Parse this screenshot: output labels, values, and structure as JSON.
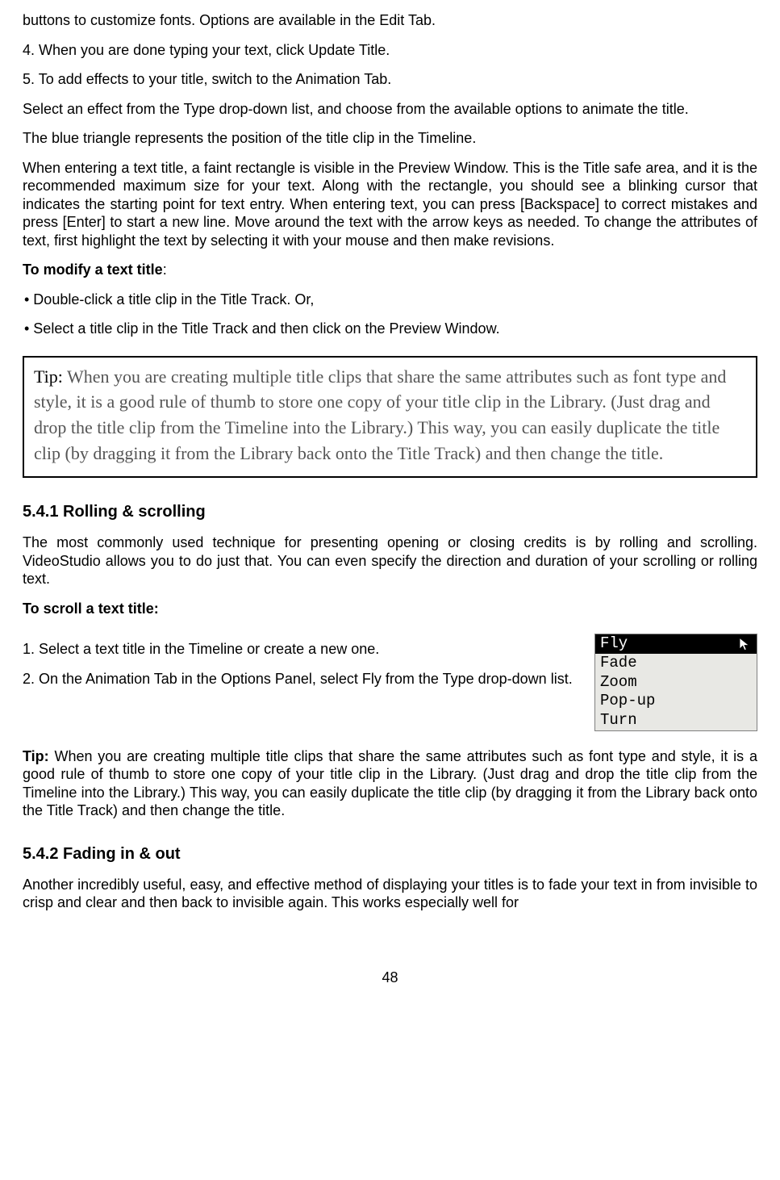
{
  "para_buttons": "buttons to customize fonts. Options are available in the Edit Tab.",
  "step4": "4. When you are done typing your text, click Update Title.",
  "step5": "5. To add effects to your title, switch to the Animation Tab.",
  "para_effect_select": "Select an effect from the Type drop-down list, and choose from the available options to animate the title.",
  "para_blue_triangle": "The blue triangle represents the position of the title clip in the Timeline.",
  "para_text_entry": "When entering a text title, a faint rectangle is visible in the Preview Window. This is the Title safe area, and it is the recommended maximum size for your text. Along with the rectangle, you should see a blinking cursor that indicates the starting point for text entry. When entering text, you can press [Backspace] to correct mistakes and press [Enter] to start a new line. Move around the text with the arrow keys as needed. To change the attributes of text, first highlight the text by selecting it with your mouse and then make revisions.",
  "modify_heading": "To modify a text title",
  "modify_colon": ":",
  "bullet1": "•  Double-click a title clip in the Title Track. Or,",
  "bullet2": "•  Select a title clip in the Title Track and then click on the Preview Window.",
  "tip_box_label": "Tip:",
  "tip_box_body": " When you are creating multiple title clips that share the same attributes such as font type and style, it is a good rule of thumb to store one copy of your title clip in the Library. (Just drag and drop the title clip from the Timeline into the Library.) This way, you can easily duplicate the title clip (by dragging it from the Library back onto the Title Track) and then change the title.",
  "h541": "5.4.1    Rolling & scrolling",
  "para_rolling_intro": "The most commonly used technique for presenting opening or closing credits is by rolling and scrolling. VideoStudio allows you to do just that. You can even specify the direction and duration of your scrolling or rolling text.",
  "scroll_heading": "To scroll a text title:",
  "scroll_step1": "1. Select a text title in the Timeline or create a new one.",
  "scroll_step2": "2. On the Animation Tab in the Options Panel, select Fly from the Type drop-down list.",
  "dropdown": {
    "selected": "Fly",
    "options": [
      "Fade",
      "Zoom",
      "Pop-up",
      "Turn"
    ]
  },
  "tip2_label": "Tip:",
  "tip2_body": " When you are creating multiple title clips that share the same attributes such as font type and style, it is a good rule of thumb to store one copy of your title clip in the Library. (Just drag and drop the title clip from the Timeline into the Library.) This way, you can easily duplicate the title clip (by dragging it from the Library back onto the Title Track) and then change the title.",
  "h542": "5.4.2    Fading in & out",
  "para_fading_intro": "Another incredibly useful, easy, and effective method of displaying your titles is to fade your text in from invisible to crisp and clear and then back to invisible again. This works especially well for",
  "page_number": "48"
}
